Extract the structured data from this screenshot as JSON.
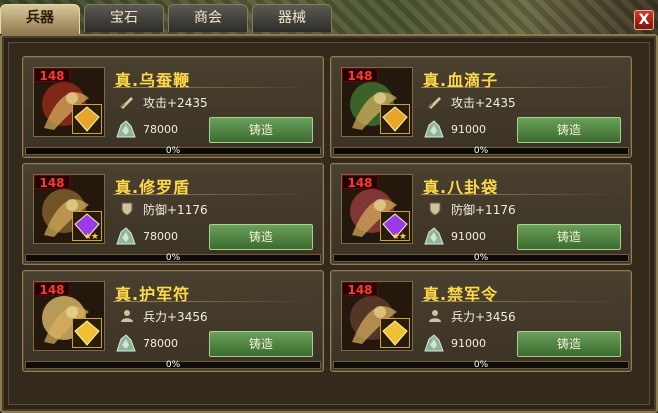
{
  "tabs": [
    {
      "label": "兵器",
      "active": true
    },
    {
      "label": "宝石",
      "active": false
    },
    {
      "label": "商会",
      "active": false
    },
    {
      "label": "器械",
      "active": false
    }
  ],
  "close_label": "X",
  "items": [
    {
      "level": "148",
      "name": "真.乌蚕鞭",
      "stat_icon": "sword-icon",
      "stat": "攻击+2435",
      "cost": "78000",
      "button": "铸造",
      "progress": 0,
      "progress_label": "0%",
      "art_color": "#8a2a1a",
      "gem_color": "#e8a52a",
      "stars": ""
    },
    {
      "level": "148",
      "name": "真.血滴子",
      "stat_icon": "sword-icon",
      "stat": "攻击+2435",
      "cost": "91000",
      "button": "铸造",
      "progress": 0,
      "progress_label": "0%",
      "art_color": "#3f6a2a",
      "gem_color": "#e8a52a",
      "stars": ""
    },
    {
      "level": "148",
      "name": "真.修罗盾",
      "stat_icon": "shield-icon",
      "stat": "防御+1176",
      "cost": "78000",
      "button": "铸造",
      "progress": 0,
      "progress_label": "0%",
      "art_color": "#7a5a2a",
      "gem_color": "#9a3ae8",
      "stars": "★★"
    },
    {
      "level": "148",
      "name": "真.八卦袋",
      "stat_icon": "shield-icon",
      "stat": "防御+1176",
      "cost": "91000",
      "button": "铸造",
      "progress": 0,
      "progress_label": "0%",
      "art_color": "#8a3a3a",
      "gem_color": "#9a3ae8",
      "stars": "★★"
    },
    {
      "level": "148",
      "name": "真.护军符",
      "stat_icon": "soldier-icon",
      "stat": "兵力+3456",
      "cost": "78000",
      "button": "铸造",
      "progress": 0,
      "progress_label": "0%",
      "art_color": "#c8a860",
      "gem_color": "#f0c030",
      "stars": ""
    },
    {
      "level": "148",
      "name": "真.禁军令",
      "stat_icon": "soldier-icon",
      "stat": "兵力+3456",
      "cost": "91000",
      "button": "铸造",
      "progress": 0,
      "progress_label": "0%",
      "art_color": "#5a3a2a",
      "gem_color": "#f0c030",
      "stars": ""
    }
  ]
}
